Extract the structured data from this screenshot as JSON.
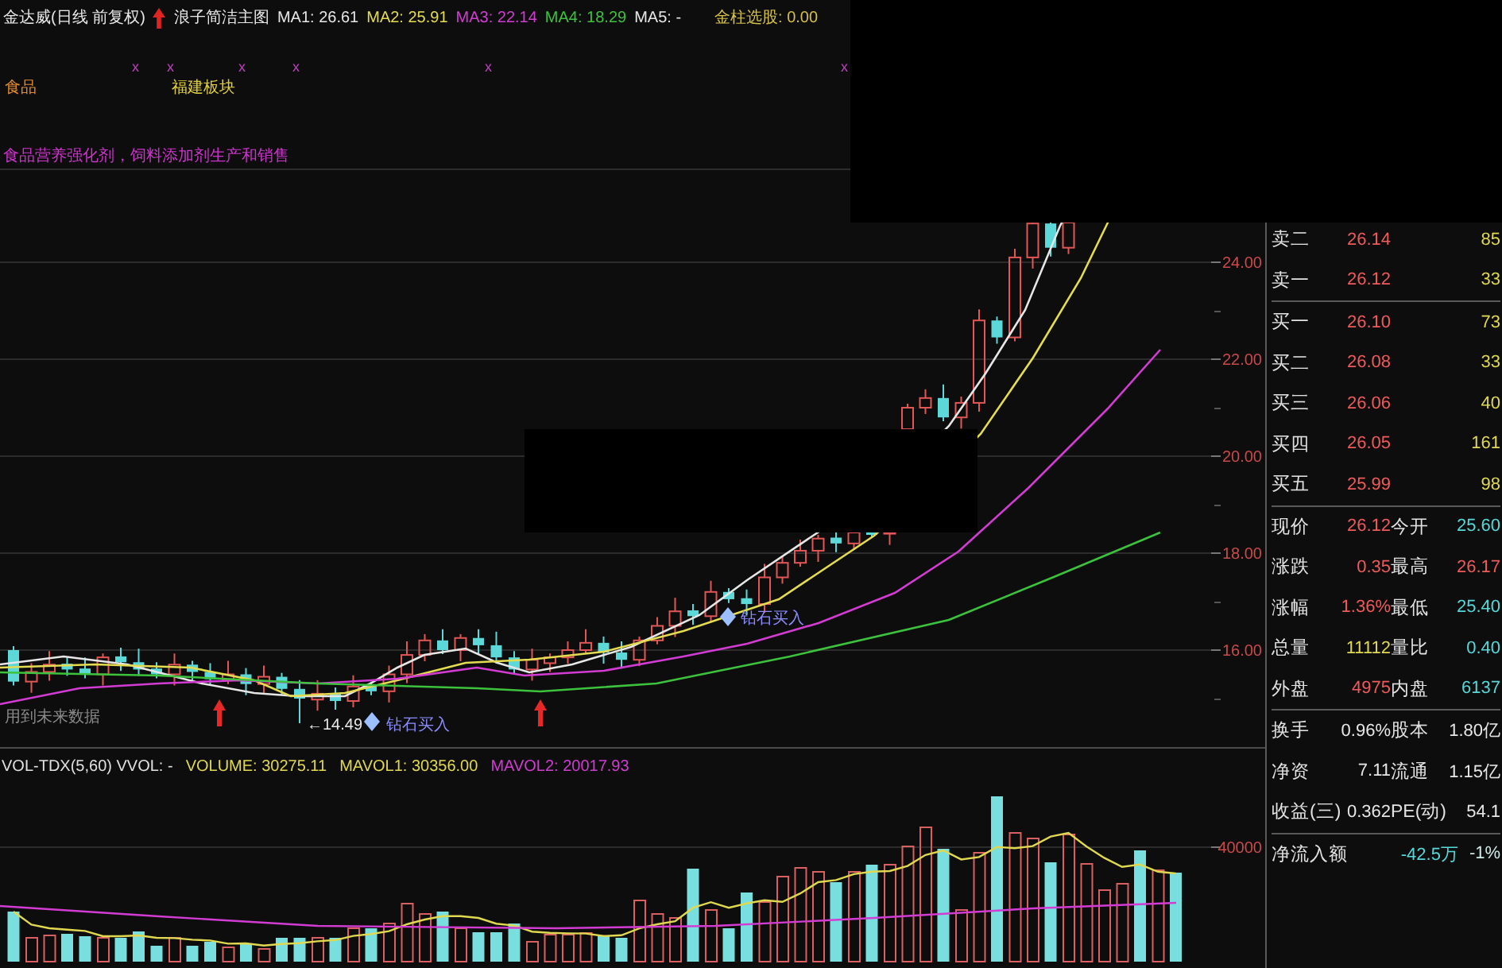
{
  "header": {
    "stock": "金达威(日线 前复权)",
    "indicator": "浪子简洁主图",
    "ma_values": [
      {
        "text": "MA1: 26.61",
        "color": "#e6e6e6"
      },
      {
        "text": "MA2: 25.91",
        "color": "#e4dc50"
      },
      {
        "text": "MA3: 22.14",
        "color": "#d23cd2"
      },
      {
        "text": "MA4: 18.29",
        "color": "#3cc23c"
      },
      {
        "text": "MA5: -",
        "color": "#e6e6e6"
      }
    ],
    "signal": "金柱选股: 0.00"
  },
  "tags_row": {
    "markers": [
      "x",
      "x",
      "x",
      "x",
      "x",
      "x"
    ],
    "tags": [
      {
        "text": "食品",
        "color": "#e08a30"
      },
      {
        "text": "福建板块",
        "color": "#e0d040"
      }
    ]
  },
  "business": "食品营养强化剂，饲料添加剂生产和销售",
  "price_chart": {
    "axis_labels": [
      "24.00",
      "22.00",
      "20.00",
      "18.00",
      "16.00"
    ],
    "note": "用到未来数据",
    "low_marker": "←14.49",
    "signals": [
      "钻石买入",
      "钻石买入"
    ]
  },
  "volume_chart": {
    "title": "VOL-TDX(5,60) VVOL: -",
    "values": [
      {
        "text": "VOLUME: 30275.11",
        "color": "#e0d850"
      },
      {
        "text": "MAVOL1: 30356.00",
        "color": "#e0d850"
      },
      {
        "text": "MAVOL2: 20017.93",
        "color": "#d23cd2"
      }
    ],
    "axis_labels": [
      "40000"
    ]
  },
  "asks": [
    {
      "label": "卖二",
      "price": "26.14",
      "volume": "85"
    },
    {
      "label": "卖一",
      "price": "26.12",
      "volume": "33"
    }
  ],
  "bids": [
    {
      "label": "买一",
      "price": "26.10",
      "volume": "73"
    },
    {
      "label": "买二",
      "price": "26.08",
      "volume": "33"
    },
    {
      "label": "买三",
      "price": "26.06",
      "volume": "40"
    },
    {
      "label": "买四",
      "price": "26.05",
      "volume": "161"
    },
    {
      "label": "买五",
      "price": "25.99",
      "volume": "98"
    }
  ],
  "quote": [
    {
      "cells": [
        {
          "label": "现价",
          "value": "26.12",
          "color": "#f05a5a"
        },
        {
          "label": "今开",
          "value": "25.60",
          "color": "#56d8d8"
        }
      ]
    },
    {
      "cells": [
        {
          "label": "涨跌",
          "value": "0.35",
          "color": "#f05a5a"
        },
        {
          "label": "最高",
          "value": "26.17",
          "color": "#f05a5a"
        }
      ]
    },
    {
      "cells": [
        {
          "label": "涨幅",
          "value": "1.36%",
          "color": "#f05a5a"
        },
        {
          "label": "最低",
          "value": "25.40",
          "color": "#56d8d8"
        }
      ]
    },
    {
      "cells": [
        {
          "label": "总量",
          "value": "11112",
          "color": "#e0d850"
        },
        {
          "label": "量比",
          "value": "0.40",
          "color": "#56d8d8"
        }
      ]
    },
    {
      "cells": [
        {
          "label": "外盘",
          "value": "4975",
          "color": "#f05a5a"
        },
        {
          "label": "内盘",
          "value": "6137",
          "color": "#56d8d8"
        }
      ]
    }
  ],
  "fundamentals": [
    {
      "cells": [
        {
          "label": "换手",
          "value": "0.96%"
        },
        {
          "label": "股本",
          "value": "1.80亿"
        }
      ]
    },
    {
      "cells": [
        {
          "label": "净资",
          "value": "7.11"
        },
        {
          "label": "流通",
          "value": "1.15亿"
        }
      ]
    },
    {
      "cells": [
        {
          "label": "收益(三)",
          "value": "0.362"
        },
        {
          "label": "PE(动)",
          "value": "54.1"
        }
      ]
    }
  ],
  "net_inflow": {
    "label": "净流入额",
    "amount": "-42.5万",
    "percent": "-1%"
  }
}
